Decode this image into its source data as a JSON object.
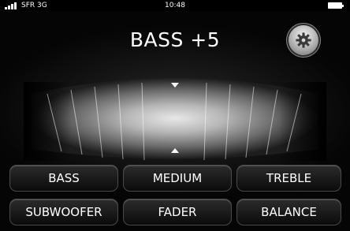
{
  "status_bar": {
    "carrier": "SFR 3G",
    "time": "10:48",
    "signal_icon": "signal-bars-icon",
    "battery_icon": "battery-full-icon"
  },
  "header": {
    "title": "BASS +5",
    "settings_icon": "gear-icon"
  },
  "buttons": {
    "bass": "BASS",
    "medium": "MEDIUM",
    "treble": "TREBLE",
    "subwoofer": "SUBWOOFER",
    "fader": "FADER",
    "balance": "BALANCE"
  }
}
